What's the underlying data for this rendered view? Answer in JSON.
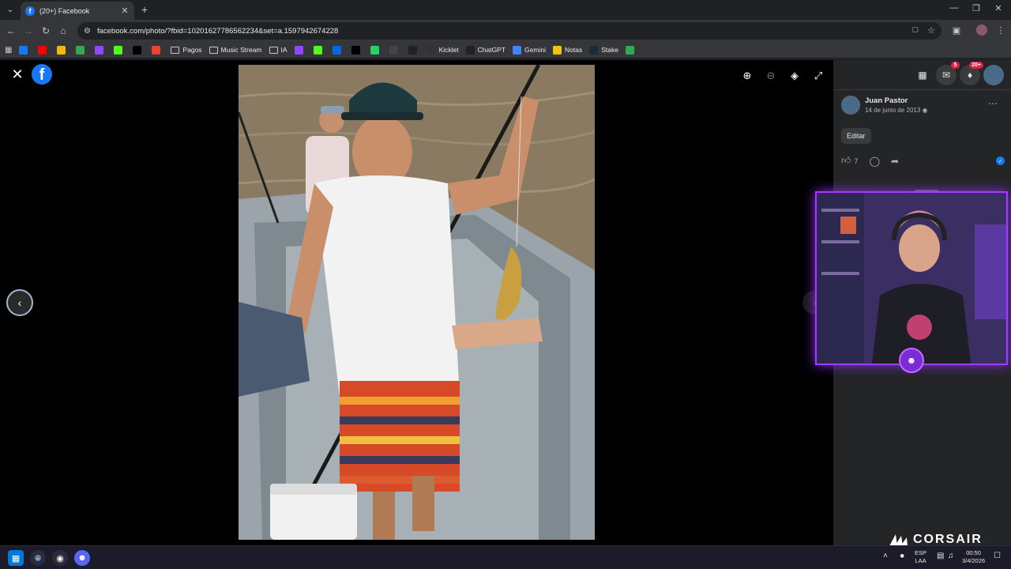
{
  "browser": {
    "tab_title": "(20+) Facebook",
    "url": "facebook.com/photo/?fbid=10201627786562234&set=a.1597942674228",
    "bookmarks": [
      {
        "label": "",
        "icon": "facebook-icon",
        "color": "#1877f2"
      },
      {
        "label": "",
        "icon": "youtube-icon",
        "color": "#ff0000"
      },
      {
        "label": "",
        "icon": "binance-icon",
        "color": "#f0b90b"
      },
      {
        "label": "",
        "icon": "drive-icon",
        "color": "#34a853"
      },
      {
        "label": "",
        "icon": "twitch-icon",
        "color": "#9146ff"
      },
      {
        "label": "",
        "icon": "kick-icon",
        "color": "#53fc18"
      },
      {
        "label": "",
        "icon": "p-icon",
        "color": "#000000"
      },
      {
        "label": "",
        "icon": "gmail-icon",
        "color": "#ea4335"
      },
      {
        "label": "Pagos",
        "icon": "folder-icon"
      },
      {
        "label": "Music Stream",
        "icon": "folder-icon"
      },
      {
        "label": "IA",
        "icon": "folder-icon"
      },
      {
        "label": "",
        "icon": "twitch-icon",
        "color": "#9146ff"
      },
      {
        "label": "",
        "icon": "kick-icon",
        "color": "#53fc18"
      },
      {
        "label": "",
        "icon": "meta-icon",
        "color": "#0668e1"
      },
      {
        "label": "",
        "icon": "tiktok-icon",
        "color": "#000000"
      },
      {
        "label": "",
        "icon": "app-icon",
        "color": "#25d366"
      },
      {
        "label": "",
        "icon": "pin-icon",
        "color": "#444444"
      },
      {
        "label": "",
        "icon": "diamond-icon",
        "color": "#222222"
      },
      {
        "label": "Kicklet",
        "icon": "kicklet-icon",
        "color": "#333333"
      },
      {
        "label": "ChatGPT",
        "icon": "chatgpt-icon",
        "color": "#222222"
      },
      {
        "label": "Gemini",
        "icon": "gemini-icon",
        "color": "#4285f4"
      },
      {
        "label": "Notas",
        "icon": "notes-icon",
        "color": "#f4c20d"
      },
      {
        "label": "Stake",
        "icon": "stake-icon",
        "color": "#1a2c38"
      },
      {
        "label": "",
        "icon": "leaf-icon",
        "color": "#34a853"
      }
    ]
  },
  "post": {
    "author": "Juan Pastor",
    "date": "14 de junio de 2013",
    "edit_label": "Editar",
    "like_count": "7"
  },
  "notifications": {
    "messenger_badge": "5",
    "notifications_badge": "20+"
  },
  "overlay": {
    "brand": "CORSAIR"
  },
  "taskbar": {
    "language": "ESP",
    "layout": "LAA",
    "time": "00:50",
    "date": "3/4/2026"
  }
}
